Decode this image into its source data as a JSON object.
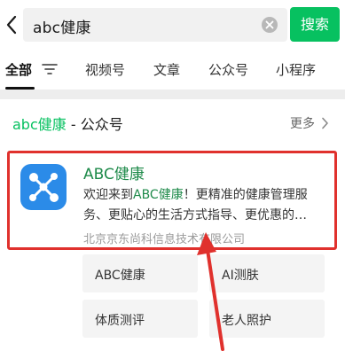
{
  "search": {
    "query": "abc健康",
    "button_label": "搜索"
  },
  "tabs": [
    {
      "label": "全部",
      "active": true
    },
    {
      "label": "视频号"
    },
    {
      "label": "文章"
    },
    {
      "label": "公众号"
    },
    {
      "label": "小程序"
    }
  ],
  "section": {
    "title_keyword": "abc健康",
    "title_suffix": " - 公众号",
    "more_label": "更多"
  },
  "result": {
    "name": "ABC健康",
    "desc_prefix": "欢迎来到",
    "desc_highlight": "ABC健康",
    "desc_suffix": "！更精准的健康管理服务、更贴心的生活方式指导、更优惠的…",
    "org": "北京京东尚科信息技术有限公司"
  },
  "quick_links": [
    "ABC健康",
    "AI测肤",
    "体质测评",
    "老人照护"
  ],
  "colors": {
    "accent": "#07c160",
    "highlight_text": "#1e8a4a",
    "annotation": "#e0312d",
    "app_icon": "#2b8be8"
  },
  "icons": {
    "back": "chevron-left-icon",
    "clear": "clear-circle-icon",
    "filter": "filter-icon",
    "more": "chevron-right-icon",
    "app": "network-nodes-icon"
  }
}
